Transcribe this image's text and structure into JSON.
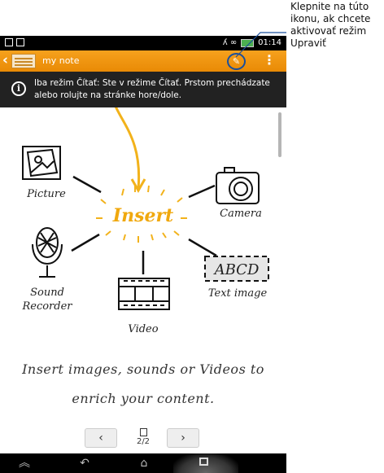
{
  "callout": {
    "lines": [
      "Klepnite na túto",
      "ikonu, ak chcete",
      "aktivovať režim",
      "Upraviť"
    ]
  },
  "status_bar": {
    "time": "01:14",
    "signal_text": "ʎ ∞"
  },
  "app_bar": {
    "back_icon": "chevron-left-icon",
    "note_icon": "note-icon",
    "title": "my note",
    "edit_icon": "pen-icon",
    "menu_icon": "overflow-menu-icon",
    "accent_color": "#f39a12",
    "edit_ring_color": "#1a4f9c"
  },
  "info_bar": {
    "icon": "info-icon",
    "text": "Iba režim Čítať: Ste v režime Čítať. Prstom prechádzate alebo rolujte na stránke hore/dole."
  },
  "drawing": {
    "center_label": "Insert",
    "items": {
      "picture": "Picture",
      "camera": "Camera",
      "sound_recorder_line1": "Sound",
      "sound_recorder_line2": "Recorder",
      "text_image_box": "ABCD",
      "text_image": "Text image",
      "video": "Video"
    },
    "caption_line1": "Insert images, sounds or Videos to",
    "caption_line2": "enrich your content."
  },
  "pager": {
    "prev": "‹",
    "next": "›",
    "page": "2/2"
  },
  "nav_bar": {
    "up_icon": "collapse-icon",
    "back_icon": "back-icon",
    "home_icon": "home-icon",
    "recent_icon": "recent-apps-icon"
  }
}
